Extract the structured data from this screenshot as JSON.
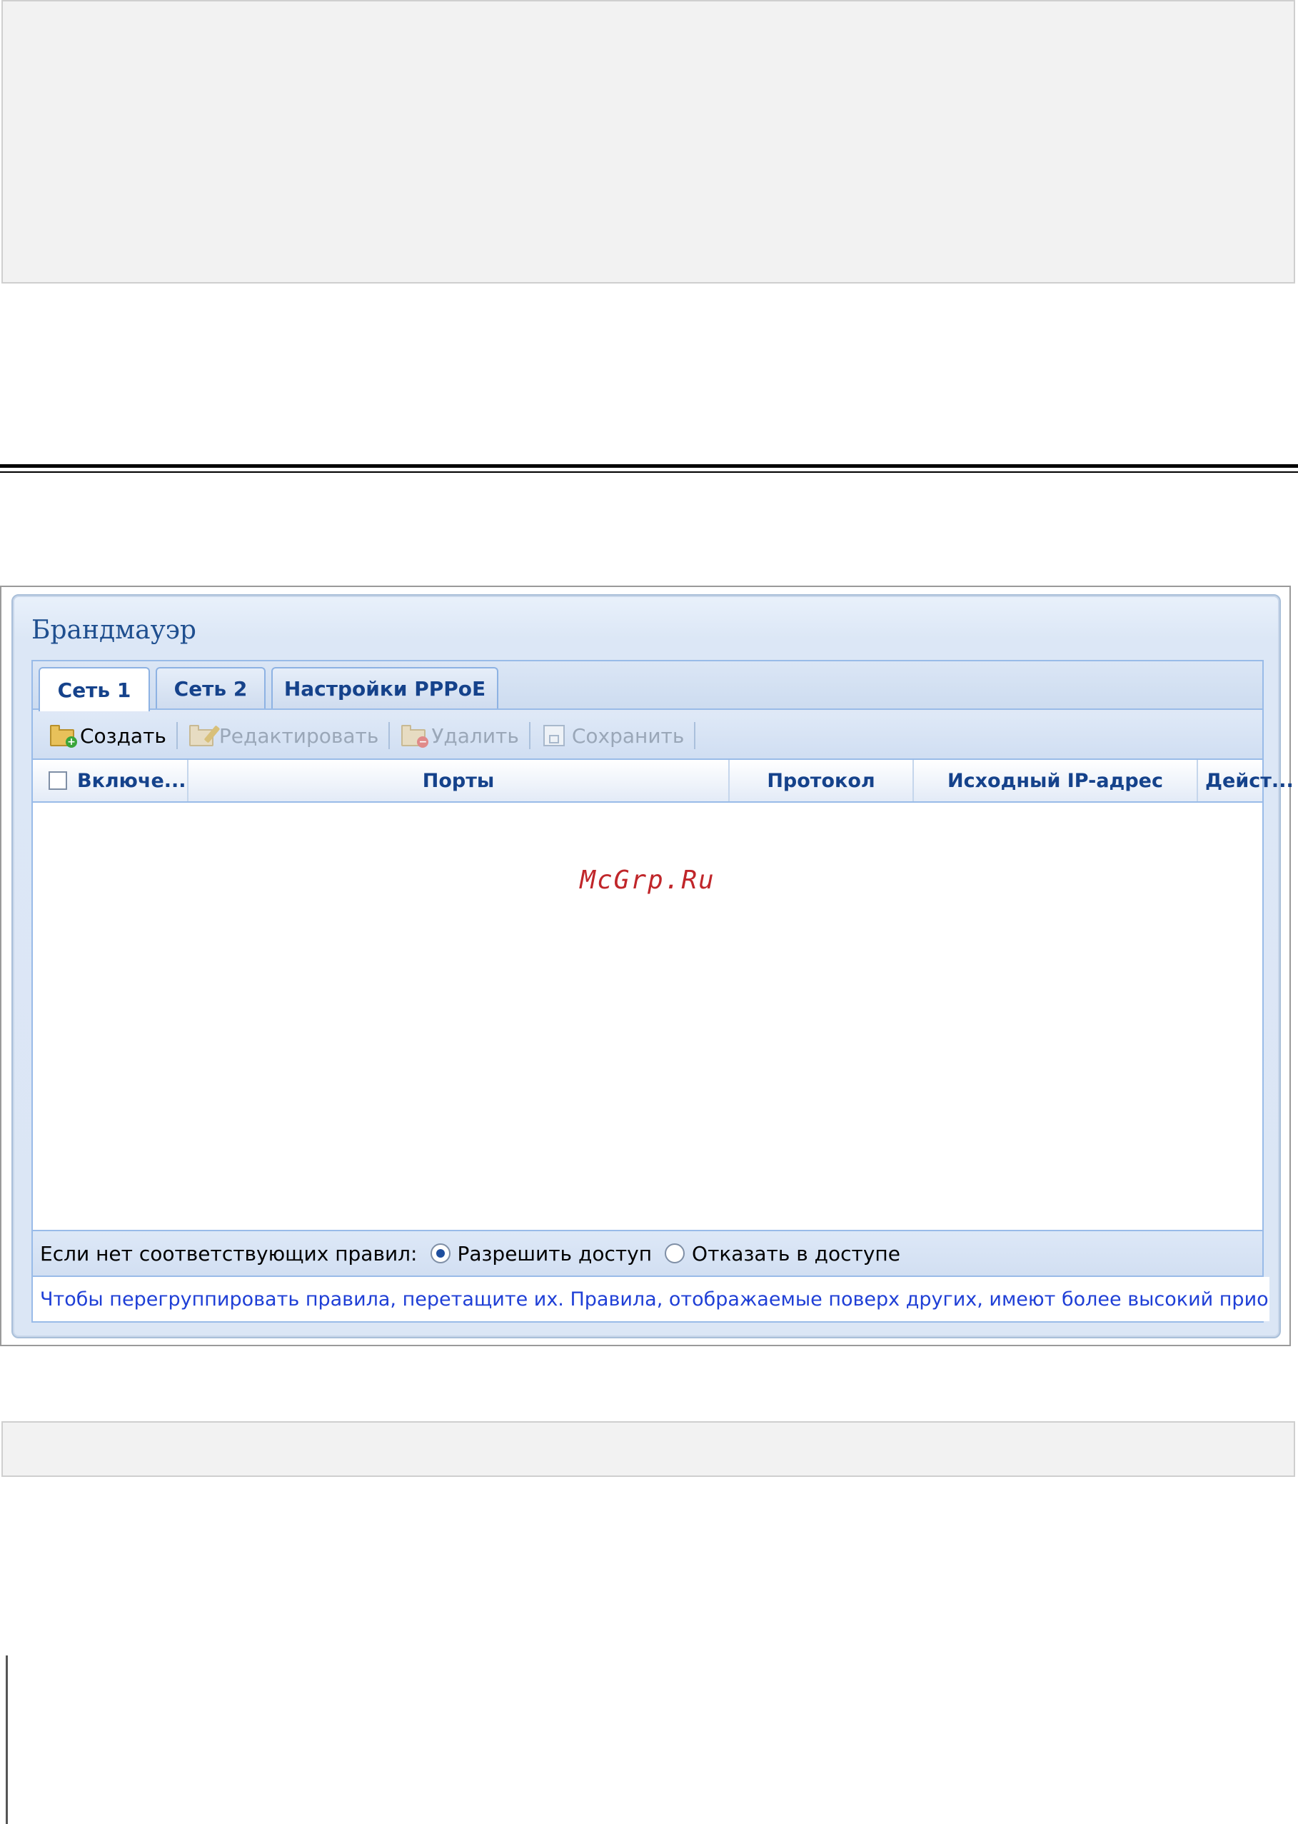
{
  "window": {
    "title": "Брандмауэр"
  },
  "tabs": [
    {
      "label": "Сеть 1",
      "active": true
    },
    {
      "label": "Сеть 2",
      "active": false
    },
    {
      "label": "Настройки PPPoE",
      "active": false
    }
  ],
  "toolbar": {
    "create_label": "Создать",
    "edit_label": "Редактировать",
    "delete_label": "Удалить",
    "save_label": "Сохранить"
  },
  "grid": {
    "columns": {
      "enabled": "Включе...",
      "ports": "Порты",
      "protocol": "Протокол",
      "source_ip": "Исходный IP-адрес",
      "action": "Дейст..."
    },
    "rows": []
  },
  "watermark": "McGrp.Ru",
  "default_rule": {
    "label": "Если нет соответствующих правил:",
    "options": [
      {
        "label": "Разрешить доступ",
        "selected": true
      },
      {
        "label": "Отказать в доступе",
        "selected": false
      }
    ]
  },
  "hint": "Чтобы перегруппировать правила, перетащите их. Правила, отображаемые поверх других, имеют более высокий приоритет"
}
